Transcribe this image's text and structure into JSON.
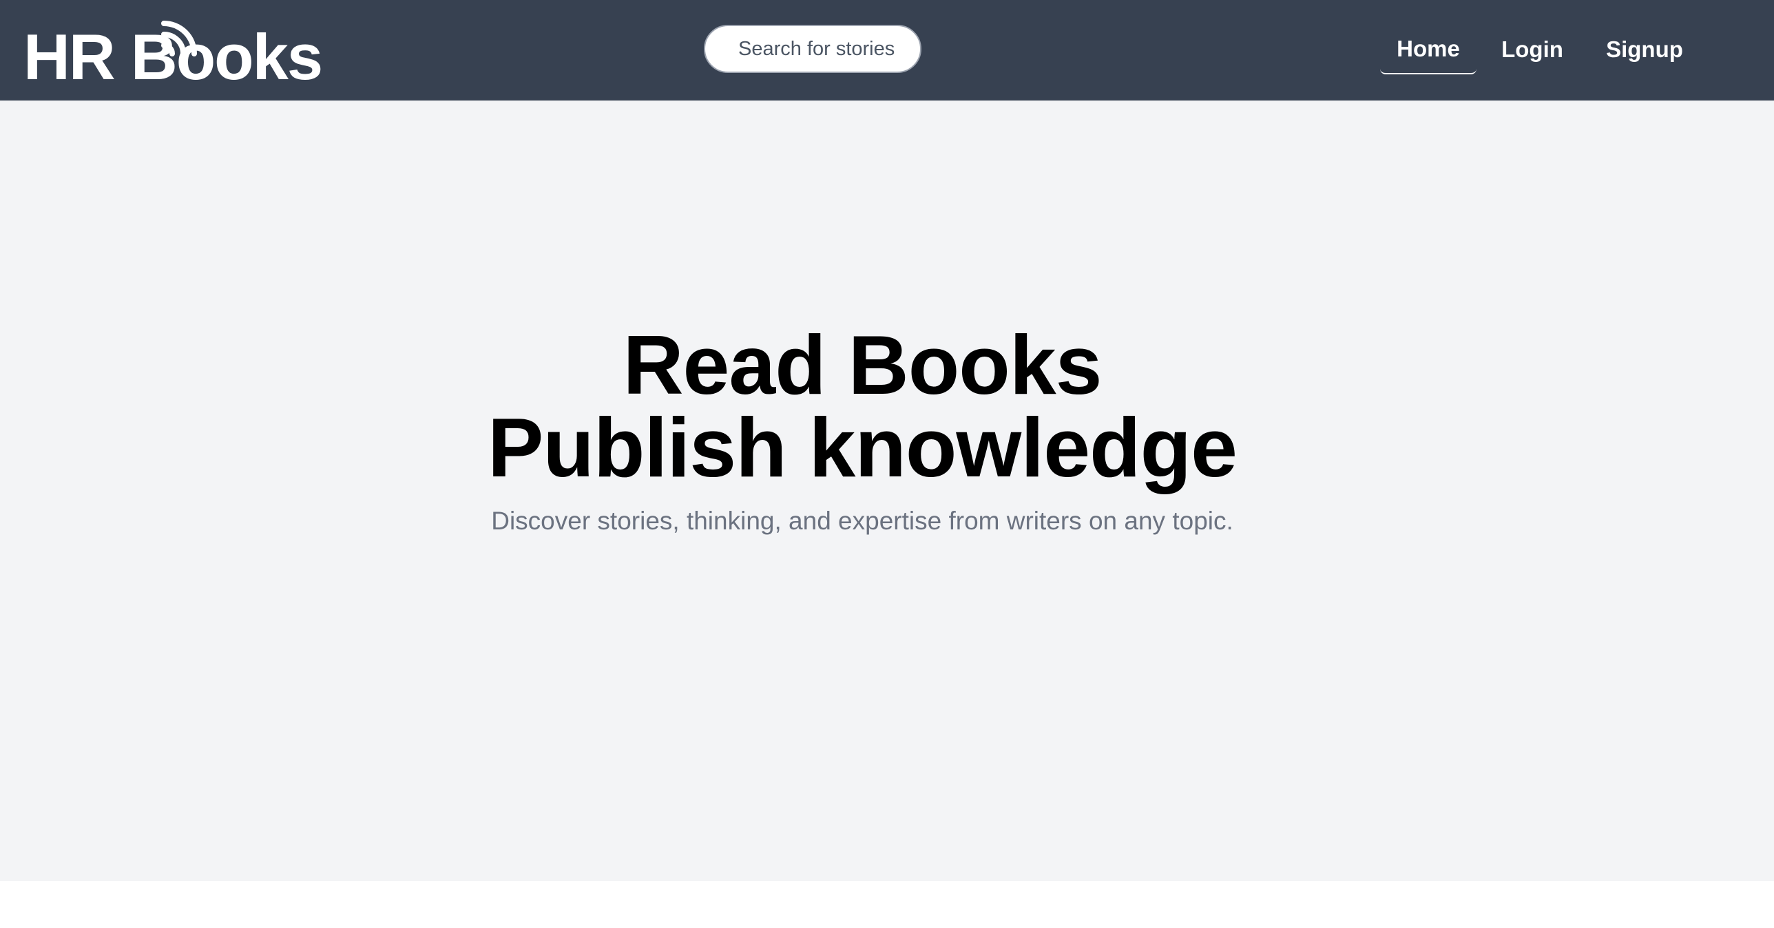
{
  "brand": {
    "name": "HR Books",
    "icon": "signal-waves-icon"
  },
  "search": {
    "placeholder": "Search for stories"
  },
  "nav": {
    "home": "Home",
    "login": "Login",
    "signup": "Signup"
  },
  "hero": {
    "line1": "Read Books",
    "line2": "Publish knowledge",
    "subtitle": "Discover stories, thinking, and expertise from writers on any topic."
  },
  "colors": {
    "navbar": "#374151",
    "hero_background": "#f3f4f6",
    "subtitle": "#6b7280",
    "heading": "#000000"
  }
}
